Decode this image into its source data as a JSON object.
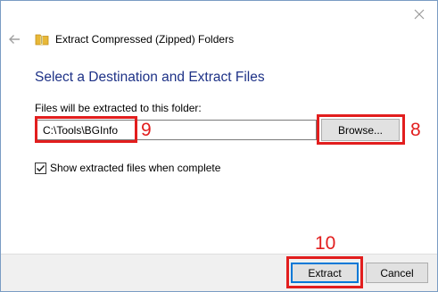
{
  "dialog": {
    "title": "Extract Compressed (Zipped) Folders",
    "heading": "Select a Destination and Extract Files",
    "field_label": "Files will be extracted to this folder:",
    "destination_value": "C:\\Tools\\BGInfo",
    "browse_label": "Browse...",
    "checkbox_label": "Show extracted files when complete",
    "checkbox_checked": true,
    "extract_label": "Extract",
    "cancel_label": "Cancel"
  },
  "annotations": {
    "destination_step": "9",
    "browse_step": "8",
    "extract_step": "10"
  },
  "icons": {
    "back": "back-arrow-icon",
    "close": "close-icon",
    "zip_folder": "zip-folder-icon",
    "check": "checkmark-icon"
  },
  "colors": {
    "heading": "#1e3287",
    "annotation": "#e21e1e",
    "default_button_border": "#0078d7",
    "footer": "#f0f0f0"
  }
}
